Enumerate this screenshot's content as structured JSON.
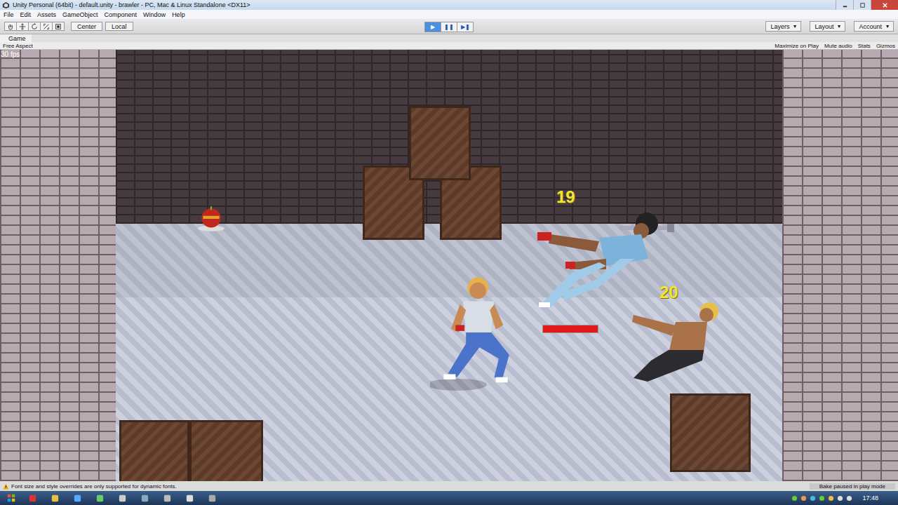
{
  "window": {
    "title": "Unity Personal (64bit) - default.unity - brawler - PC, Mac & Linux Standalone <DX11>"
  },
  "menu": [
    "File",
    "Edit",
    "Assets",
    "GameObject",
    "Component",
    "Window",
    "Help"
  ],
  "toolbar": {
    "pivot": "Center",
    "space": "Local",
    "play_controls": [
      {
        "label": "▶",
        "selected": true
      },
      {
        "label": "❚❚",
        "selected": false
      },
      {
        "label": "▶❚",
        "selected": false
      }
    ],
    "dropdowns": [
      "Layers",
      "Layout",
      "Account"
    ]
  },
  "game_view": {
    "tab": "Game",
    "aspect": "Free Aspect",
    "toggles": [
      {
        "label": "Maximize on Play",
        "on": false
      },
      {
        "label": "Mute audio",
        "on": false
      },
      {
        "label": "Stats",
        "on": false
      },
      {
        "label": "Gizmos",
        "on": false
      }
    ],
    "fps": "30 fps"
  },
  "scene": {
    "damage_numbers": [
      "19",
      "20"
    ],
    "health_bar": {
      "level": 1
    }
  },
  "status_bar": {
    "message": "Font size and style overrides are only supported for dynamic fonts.",
    "bake": "Bake paused in play mode"
  },
  "taskbar": {
    "time": "17:48"
  }
}
